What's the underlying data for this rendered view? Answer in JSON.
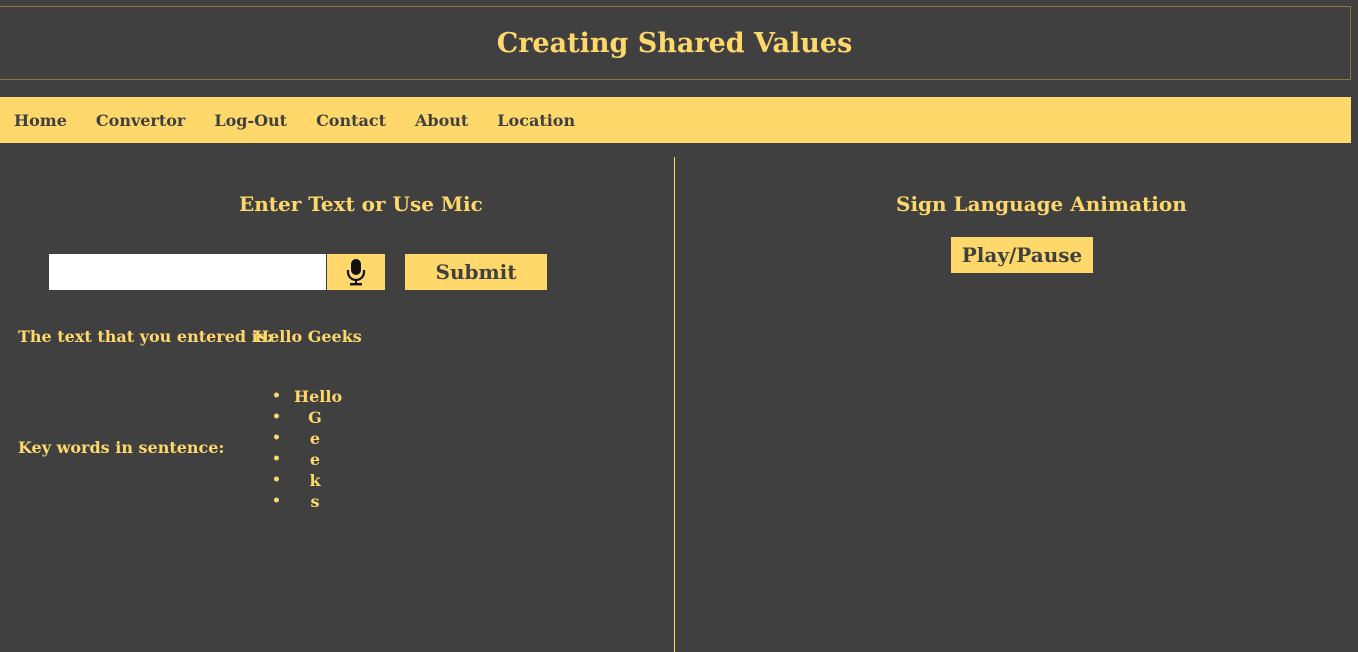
{
  "header": {
    "title": "Creating Shared Values"
  },
  "nav": {
    "items": [
      "Home",
      "Convertor",
      "Log-Out",
      "Contact",
      "About",
      "Location"
    ]
  },
  "left_panel": {
    "heading": "Enter Text or Use Mic",
    "input": {
      "value": "",
      "placeholder": ""
    },
    "mic_icon": "microphone-icon",
    "submit_label": "Submit",
    "entered_label": "The text that you entered is:",
    "entered_value": "Hello Geeks",
    "keywords_label": "Key words in sentence:",
    "keywords": [
      "Hello",
      "G",
      "e",
      "e",
      "k",
      "s"
    ]
  },
  "right_panel": {
    "heading": "Sign Language Animation",
    "play_label": "Play/Pause"
  },
  "colors": {
    "background": "#404040",
    "accent": "#ffd86b"
  }
}
